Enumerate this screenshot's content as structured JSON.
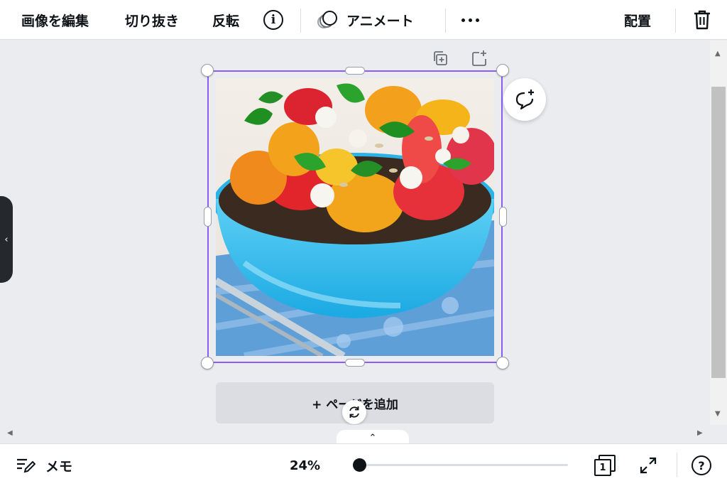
{
  "toolbar": {
    "edit_image": "画像を編集",
    "crop": "切り抜き",
    "flip": "反転",
    "animate": "アニメート",
    "position": "配置"
  },
  "canvas": {
    "add_page": "+ ページを追加"
  },
  "bottom_bar": {
    "notes": "メモ",
    "zoom_value": "24%",
    "zoom_level": 0.24,
    "page_number": "1"
  },
  "colors": {
    "selection": "#8b5cf6",
    "toolbar_bg": "#ffffff",
    "canvas_bg": "#ebecf0",
    "text": "#0e1318"
  },
  "icons": [
    "info-icon",
    "animate-icon",
    "more-icon",
    "trash-icon",
    "duplicate-page-icon",
    "add-page-icon",
    "add-comment-icon",
    "rotate-icon",
    "notes-icon",
    "pages-icon",
    "fullscreen-icon",
    "help-icon",
    "collapse-panel-icon",
    "expand-pages-icon"
  ]
}
